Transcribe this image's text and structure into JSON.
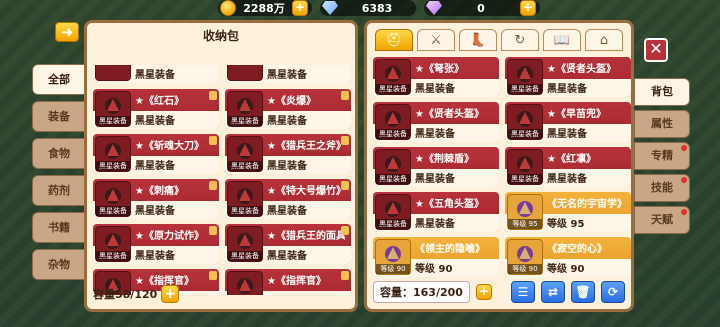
{
  "currency": {
    "gold": "2288万",
    "diamond": "6383",
    "purple": "0"
  },
  "storage": {
    "title": "收纳包",
    "capacity_label": "容量58/120",
    "items": [
      {
        "name": "★《红石》",
        "sub": "黑星装备"
      },
      {
        "name": "★《炎爆》",
        "sub": "黑星装备"
      },
      {
        "name": "★《斩魂大刀》",
        "sub": "黑星装备"
      },
      {
        "name": "★《猎兵王之斧》",
        "sub": "黑星装备"
      },
      {
        "name": "★《刺痛》",
        "sub": "黑星装备"
      },
      {
        "name": "★《特大号爆竹》",
        "sub": "黑星装备"
      },
      {
        "name": "★《原力试作》",
        "sub": "黑星装备"
      },
      {
        "name": "★《猎兵王的面具》",
        "sub": "黑星装备"
      },
      {
        "name": "★《指挥官》",
        "sub": ""
      },
      {
        "name": "★《指挥官》",
        "sub": ""
      }
    ],
    "top_row_sub": "黑星装备"
  },
  "backpack": {
    "capacity_label": "容量：163/200",
    "items": [
      {
        "name": "★《弩张》",
        "sub": "黑星装备",
        "type": "red"
      },
      {
        "name": "★《贤者头盔》",
        "sub": "黑星装备",
        "type": "red"
      },
      {
        "name": "★《贤者头盔》",
        "sub": "黑星装备",
        "type": "red"
      },
      {
        "name": "★《早苗兜》",
        "sub": "黑星装备",
        "type": "red"
      },
      {
        "name": "★《荆棘盾》",
        "sub": "黑星装备",
        "type": "red"
      },
      {
        "name": "★《红凛》",
        "sub": "黑星装备",
        "type": "red"
      },
      {
        "name": "★《五角头盔》",
        "sub": "黑星装备",
        "type": "red"
      },
      {
        "name": "《无名的宇宙学》",
        "sub": "等级 95",
        "type": "gold",
        "tag": "等级 95"
      },
      {
        "name": "《领主的隐喻》",
        "sub": "等级 90",
        "type": "gold",
        "tag": "等级 90"
      },
      {
        "name": "《寂空的心》",
        "sub": "等级 90",
        "type": "gold",
        "tag": "等级 90"
      }
    ]
  },
  "left_tabs": [
    "全部",
    "装备",
    "食物",
    "药剂",
    "书籍",
    "杂物"
  ],
  "right_tabs": [
    "背包",
    "属性",
    "专精",
    "技能",
    "天赋"
  ],
  "icon_tag": "黑星装备"
}
